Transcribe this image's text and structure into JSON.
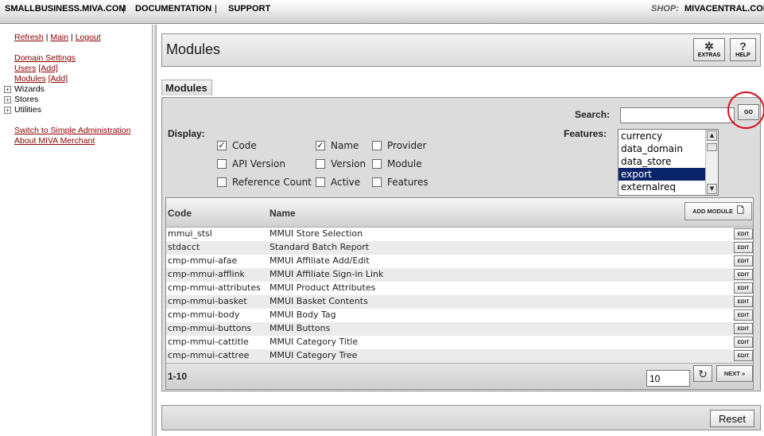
{
  "topnav": {
    "links": [
      "SMALLBUSINESS.MIVA.COM",
      "DOCUMENTATION",
      "SUPPORT"
    ],
    "separator": "|",
    "shop_label": "SHOP:",
    "shop_link": "MIVACENTRAL.COM"
  },
  "sidebar": {
    "refresh": "Refresh",
    "main": "Main",
    "logout": "Logout",
    "sep": "|",
    "domain_settings": "Domain Settings",
    "users": "Users",
    "users_add": "[Add]",
    "modules": "Modules",
    "modules_add": "[Add]",
    "tree": [
      "Wizards",
      "Stores",
      "Utilities"
    ],
    "tree_toggle": "+",
    "switch_simple": "Switch to Simple Administration",
    "about": "About MIVA Merchant"
  },
  "header": {
    "title": "Modules",
    "extras_label": "EXTRAS",
    "help_label": "HELP"
  },
  "section_tab": "Modules",
  "search": {
    "label": "Search:",
    "value": "",
    "go_label": "GO"
  },
  "display": {
    "label": "Display:",
    "check_mark": "✓",
    "options": [
      {
        "label": "Code",
        "checked": true
      },
      {
        "label": "Name",
        "checked": true
      },
      {
        "label": "Provider",
        "checked": false
      },
      {
        "label": "API Version",
        "checked": false
      },
      {
        "label": "Version",
        "checked": false
      },
      {
        "label": "Module",
        "checked": false
      },
      {
        "label": "Reference Count",
        "checked": false
      },
      {
        "label": "Active",
        "checked": false
      },
      {
        "label": "Features",
        "checked": false
      }
    ]
  },
  "features": {
    "label": "Features:",
    "options": [
      "currency",
      "data_domain",
      "data_store",
      "export",
      "externalreq"
    ],
    "selected": "export"
  },
  "grid": {
    "columns": [
      "Code",
      "Name"
    ],
    "add_module_label": "ADD MODULE",
    "edit_label": "EDIT",
    "rows": [
      {
        "code": "mmui_stsl",
        "name": "MMUI Store Selection"
      },
      {
        "code": "stdacct",
        "name": "Standard Batch Report"
      },
      {
        "code": "cmp-mmui-afae",
        "name": "MMUI Affiliate Add/Edit"
      },
      {
        "code": "cmp-mmui-afflink",
        "name": "MMUI Affiliate Sign-in Link"
      },
      {
        "code": "cmp-mmui-attributes",
        "name": "MMUI Product Attributes"
      },
      {
        "code": "cmp-mmui-basket",
        "name": "MMUI Basket Contents"
      },
      {
        "code": "cmp-mmui-body",
        "name": "MMUI Body Tag"
      },
      {
        "code": "cmp-mmui-buttons",
        "name": "MMUI Buttons"
      },
      {
        "code": "cmp-mmui-cattitle",
        "name": "MMUI Category Title"
      },
      {
        "code": "cmp-mmui-cattree",
        "name": "MMUI Category Tree"
      }
    ],
    "range": "1-10",
    "page_size": "10",
    "refresh_icon": "↻",
    "next_label": "NEXT »"
  },
  "footer": {
    "reset_label": "Reset"
  }
}
